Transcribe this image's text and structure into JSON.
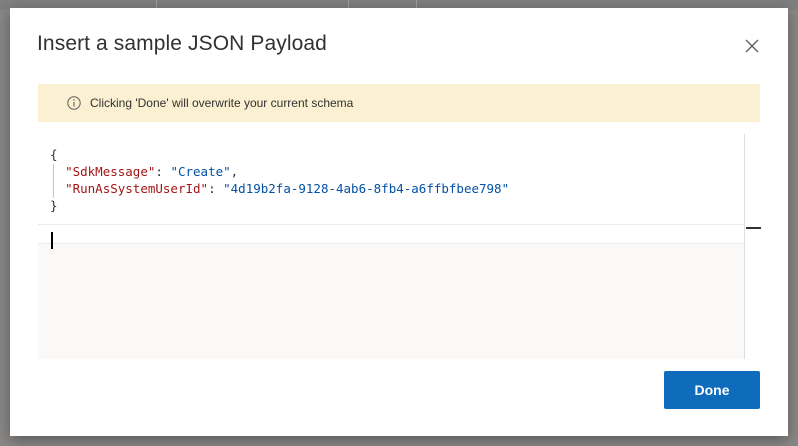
{
  "dialog": {
    "title": "Insert a sample JSON Payload",
    "close_icon": "close-icon",
    "banner": {
      "icon": "info-icon",
      "text": "Clicking 'Done' will overwrite your current schema"
    },
    "editor": {
      "line1": "{",
      "key1": "\"SdkMessage\"",
      "sep1": ": ",
      "val1": "\"Create\"",
      "trail1": ",",
      "key2": "\"RunAsSystemUserId\"",
      "sep2": ": ",
      "val2": "\"4d19b2fa-9128-4ab6-8fb4-a6ffbfbee798\"",
      "line4": "}"
    },
    "done_label": "Done"
  },
  "colors": {
    "accent": "#0f6cbd",
    "banner_background": "#fcf0d3",
    "json_key": "#a31515",
    "json_string": "#0451a5"
  }
}
